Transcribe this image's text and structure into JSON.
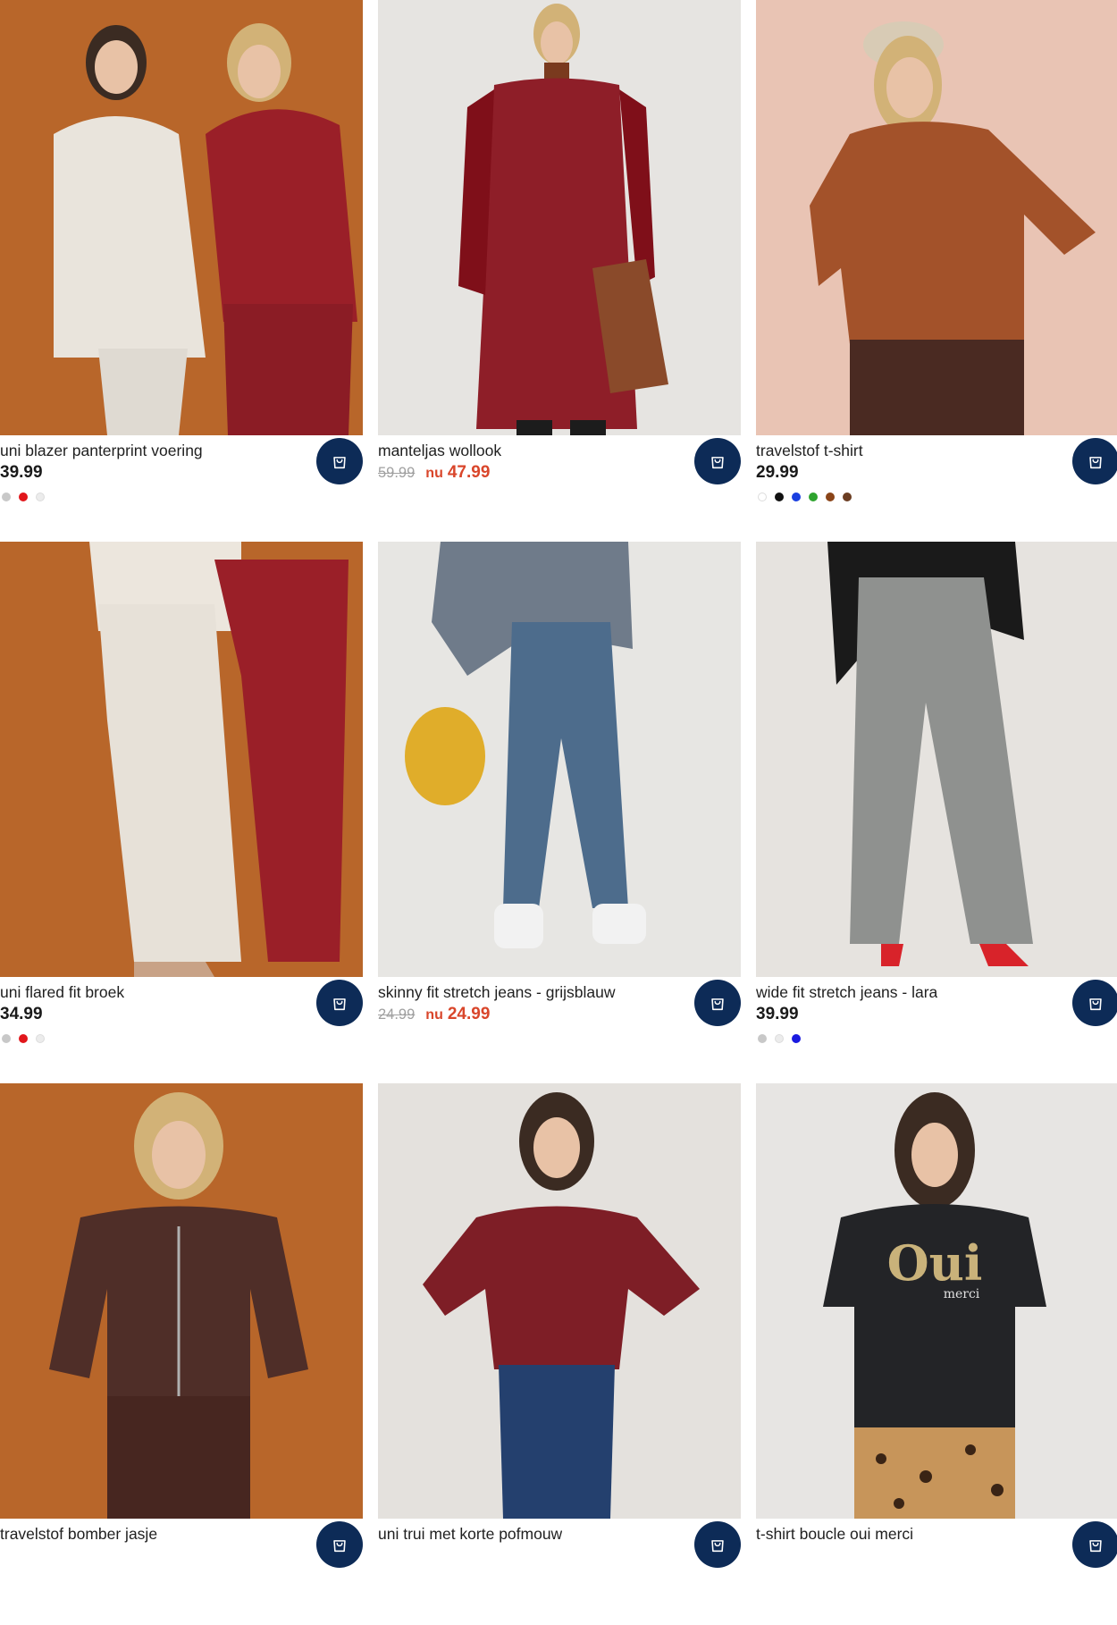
{
  "products": [
    {
      "title": "uni blazer panterprint voering",
      "price": "39.99",
      "on_sale": false,
      "bg_color": "#b8662a",
      "garment_color": "#e9e4dc",
      "swatches": [
        "#c8c8c8",
        "#e1161b",
        "#ececec"
      ],
      "image": "two-women-blazer-suits-photo"
    },
    {
      "title": "manteljas wollook",
      "old_price": "59.99",
      "now_label": "nu",
      "sale_price": "47.99",
      "on_sale": true,
      "bg_color": "#e6e4e1",
      "garment_color": "#8e1e28",
      "swatches": [],
      "image": "woman-red-coat-photo"
    },
    {
      "title": "travelstof t-shirt",
      "price": "29.99",
      "on_sale": false,
      "bg_color": "#e9c4b4",
      "garment_color": "#a3522a",
      "swatches": [
        "#ffffff",
        "#111111",
        "#1a3fe0",
        "#2ea32e",
        "#8a4418",
        "#6b3d22"
      ],
      "image": "woman-brown-tshirt-photo"
    },
    {
      "title": "uni flared fit broek",
      "price": "34.99",
      "on_sale": false,
      "bg_color": "#b8662a",
      "garment_color": "#e7e1d8",
      "swatches": [
        "#c8c8c8",
        "#e1161b",
        "#ececec"
      ],
      "image": "flared-trousers-photo"
    },
    {
      "title": "skinny fit stretch jeans - grijsblauw",
      "old_price": "24.99",
      "now_label": "nu",
      "sale_price": "24.99",
      "on_sale": true,
      "bg_color": "#e7e6e3",
      "garment_color": "#4d6c8c",
      "swatches": [],
      "image": "skinny-jeans-photo"
    },
    {
      "title": "wide fit stretch jeans - lara",
      "price": "39.99",
      "on_sale": false,
      "bg_color": "#e6e3df",
      "garment_color": "#8f918f",
      "swatches": [
        "#c8c8c8",
        "#ececec",
        "#1a1ae0"
      ],
      "image": "wide-jeans-photo"
    },
    {
      "title": "travelstof bomber jasje",
      "on_sale": false,
      "bg_color": "#b8662a",
      "garment_color": "#4f2e28",
      "swatches": [],
      "image": "woman-bomber-jacket-photo"
    },
    {
      "title": "uni trui met korte pofmouw",
      "on_sale": false,
      "bg_color": "#e4e1dd",
      "garment_color": "#7e1e26",
      "swatches": [],
      "image": "woman-puff-sleeve-sweater-photo"
    },
    {
      "title": "t-shirt boucle oui merci",
      "on_sale": false,
      "bg_color": "#e7e5e3",
      "garment_color": "#232427",
      "print_text": "Oui",
      "print_subtext": "merci",
      "swatches": [],
      "image": "woman-black-tshirt-photo"
    }
  ],
  "cart_icon": "shopping-bag-icon",
  "cart_button_color": "#0d2b57"
}
